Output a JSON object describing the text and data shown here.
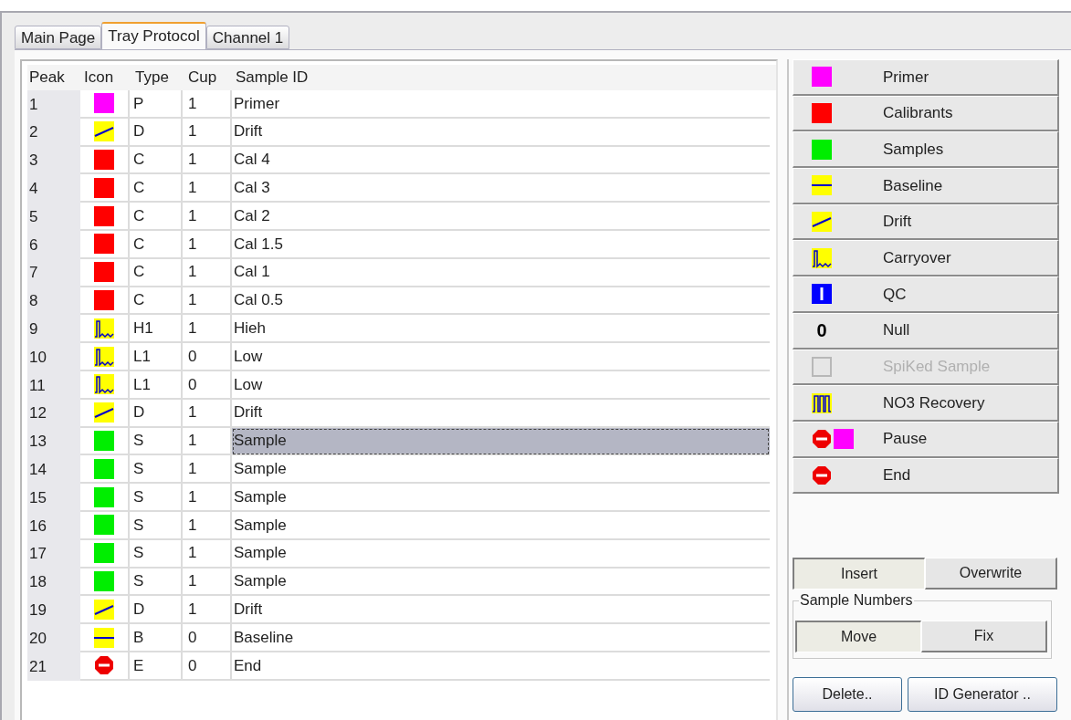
{
  "tabs": [
    {
      "label": "Main Page",
      "selected": false
    },
    {
      "label": "Tray Protocol",
      "selected": true
    },
    {
      "label": "Channel 1",
      "selected": false
    }
  ],
  "table": {
    "columns": [
      "Peak",
      "Icon",
      "Type",
      "Cup",
      "Sample ID"
    ],
    "rows": [
      {
        "peak": "1",
        "icon": {
          "kind": "square",
          "color": "#ff00ff"
        },
        "type": "P",
        "cup": "1",
        "sample_id": "Primer",
        "selected": false
      },
      {
        "peak": "2",
        "icon": {
          "kind": "drift"
        },
        "type": "D",
        "cup": "1",
        "sample_id": "Drift",
        "selected": false
      },
      {
        "peak": "3",
        "icon": {
          "kind": "square",
          "color": "#ff0000"
        },
        "type": "C",
        "cup": "1",
        "sample_id": "Cal 4",
        "selected": false
      },
      {
        "peak": "4",
        "icon": {
          "kind": "square",
          "color": "#ff0000"
        },
        "type": "C",
        "cup": "1",
        "sample_id": "Cal 3",
        "selected": false
      },
      {
        "peak": "5",
        "icon": {
          "kind": "square",
          "color": "#ff0000"
        },
        "type": "C",
        "cup": "1",
        "sample_id": "Cal 2",
        "selected": false
      },
      {
        "peak": "6",
        "icon": {
          "kind": "square",
          "color": "#ff0000"
        },
        "type": "C",
        "cup": "1",
        "sample_id": "Cal 1.5",
        "selected": false
      },
      {
        "peak": "7",
        "icon": {
          "kind": "square",
          "color": "#ff0000"
        },
        "type": "C",
        "cup": "1",
        "sample_id": "Cal 1",
        "selected": false
      },
      {
        "peak": "8",
        "icon": {
          "kind": "square",
          "color": "#ff0000"
        },
        "type": "C",
        "cup": "1",
        "sample_id": "Cal 0.5",
        "selected": false
      },
      {
        "peak": "9",
        "icon": {
          "kind": "carryover"
        },
        "type": "H1",
        "cup": "1",
        "sample_id": "Hieh",
        "selected": false
      },
      {
        "peak": "10",
        "icon": {
          "kind": "carryover"
        },
        "type": "L1",
        "cup": "0",
        "sample_id": "Low",
        "selected": false
      },
      {
        "peak": "11",
        "icon": {
          "kind": "carryover"
        },
        "type": "L1",
        "cup": "0",
        "sample_id": "Low",
        "selected": false
      },
      {
        "peak": "12",
        "icon": {
          "kind": "drift"
        },
        "type": "D",
        "cup": "1",
        "sample_id": "Drift",
        "selected": false
      },
      {
        "peak": "13",
        "icon": {
          "kind": "square",
          "color": "#00ee00"
        },
        "type": "S",
        "cup": "1",
        "sample_id": "Sample",
        "selected": true
      },
      {
        "peak": "14",
        "icon": {
          "kind": "square",
          "color": "#00ee00"
        },
        "type": "S",
        "cup": "1",
        "sample_id": "Sample",
        "selected": false
      },
      {
        "peak": "15",
        "icon": {
          "kind": "square",
          "color": "#00ee00"
        },
        "type": "S",
        "cup": "1",
        "sample_id": "Sample",
        "selected": false
      },
      {
        "peak": "16",
        "icon": {
          "kind": "square",
          "color": "#00ee00"
        },
        "type": "S",
        "cup": "1",
        "sample_id": "Sample",
        "selected": false
      },
      {
        "peak": "17",
        "icon": {
          "kind": "square",
          "color": "#00ee00"
        },
        "type": "S",
        "cup": "1",
        "sample_id": "Sample",
        "selected": false
      },
      {
        "peak": "18",
        "icon": {
          "kind": "square",
          "color": "#00ee00"
        },
        "type": "S",
        "cup": "1",
        "sample_id": "Sample",
        "selected": false
      },
      {
        "peak": "19",
        "icon": {
          "kind": "drift"
        },
        "type": "D",
        "cup": "1",
        "sample_id": "Drift",
        "selected": false
      },
      {
        "peak": "20",
        "icon": {
          "kind": "baseline"
        },
        "type": "B",
        "cup": "0",
        "sample_id": "Baseline",
        "selected": false
      },
      {
        "peak": "21",
        "icon": {
          "kind": "stop"
        },
        "type": "E",
        "cup": "0",
        "sample_id": "End",
        "selected": false
      }
    ]
  },
  "palette": [
    {
      "label": "Primer",
      "icon": {
        "kind": "square",
        "color": "#ff00ff"
      },
      "disabled": false
    },
    {
      "label": "Calibrants",
      "icon": {
        "kind": "square",
        "color": "#ff0000"
      },
      "disabled": false
    },
    {
      "label": "Samples",
      "icon": {
        "kind": "square",
        "color": "#00ee00"
      },
      "disabled": false
    },
    {
      "label": "Baseline",
      "icon": {
        "kind": "baseline"
      },
      "disabled": false
    },
    {
      "label": "Drift",
      "icon": {
        "kind": "drift"
      },
      "disabled": false
    },
    {
      "label": "Carryover",
      "icon": {
        "kind": "carryover"
      },
      "disabled": false
    },
    {
      "label": "QC",
      "icon": {
        "kind": "qc"
      },
      "disabled": false
    },
    {
      "label": "Null",
      "icon": {
        "kind": "glyph",
        "text": "0"
      },
      "disabled": false
    },
    {
      "label": "SpiKed Sample",
      "icon": {
        "kind": "empty"
      },
      "disabled": true
    },
    {
      "label": "NO3 Recovery",
      "icon": {
        "kind": "recovery"
      },
      "disabled": false
    },
    {
      "label": "Pause",
      "icon": {
        "kind": "pause"
      },
      "disabled": false
    },
    {
      "label": "End",
      "icon": {
        "kind": "stop"
      },
      "disabled": false
    }
  ],
  "edit_mode": [
    {
      "label": "Insert",
      "selected": true
    },
    {
      "label": "Overwrite",
      "selected": false
    }
  ],
  "sample_numbers": {
    "title": "Sample Numbers",
    "options": [
      {
        "label": "Move",
        "selected": true
      },
      {
        "label": "Fix",
        "selected": false
      }
    ]
  },
  "buttons": [
    "Delete..",
    "ID Generator .."
  ]
}
